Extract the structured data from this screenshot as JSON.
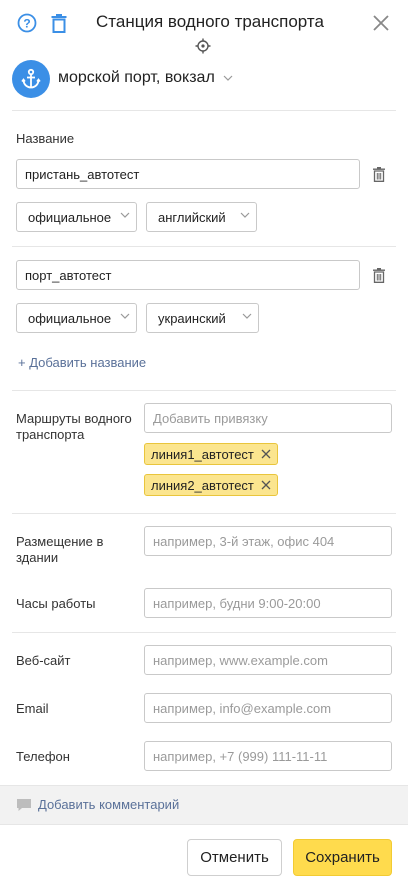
{
  "header": {
    "title": "Станция водного транспорта"
  },
  "category": {
    "label": "морской порт, вокзал"
  },
  "names": {
    "section_label": "Название",
    "entries": [
      {
        "value": "пристань_автотест",
        "type": "официальное",
        "language": "английский"
      },
      {
        "value": "порт_автотест",
        "type": "официальное",
        "language": "украинский"
      }
    ],
    "add_label": "+ Добавить название"
  },
  "routes": {
    "label": "Маршруты водного транспорта",
    "placeholder": "Добавить привязку",
    "chips": [
      "линия1_автотест",
      "линия2_автотест"
    ]
  },
  "placement": {
    "label": "Размещение в здании",
    "placeholder": "например, 3-й этаж, офис 404"
  },
  "hours": {
    "label": "Часы работы",
    "placeholder": "например, будни 9:00-20:00"
  },
  "website": {
    "label": "Веб-сайт",
    "placeholder": "например, www.example.com"
  },
  "email": {
    "label": "Email",
    "placeholder": "например, info@example.com"
  },
  "phone": {
    "label": "Телефон",
    "placeholder": "например, +7 (999) 111-11-11"
  },
  "comment": {
    "label": "Добавить комментарий"
  },
  "footer": {
    "cancel_label": "Отменить",
    "save_label": "Сохранить"
  },
  "colors": {
    "accent_blue": "#3b8fe6",
    "chip_yellow": "#fbe58f",
    "save_yellow": "#ffdb4d"
  }
}
